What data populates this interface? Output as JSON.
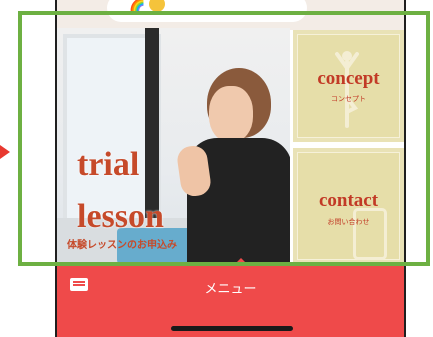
{
  "hero": {
    "title_line1": "trial",
    "title_line2": "lesson",
    "subtitle": "体験レッスンのお申込み"
  },
  "tiles": [
    {
      "label": "concept",
      "sublabel": "コンセプト"
    },
    {
      "label": "contact",
      "sublabel": "お問い合わせ"
    }
  ],
  "menu": {
    "label": "メニュー"
  },
  "colors": {
    "accent_red": "#ef4a4a",
    "highlight_green": "#6db042",
    "tile_bg": "#e9e2b6",
    "title_red": "#c64a2a"
  },
  "icons": [
    "keyboard-icon",
    "rainbow-emoji-icon",
    "smile-emoji-icon",
    "yoga-pose-icon",
    "smartphone-icon",
    "arrow-right-icon"
  ]
}
